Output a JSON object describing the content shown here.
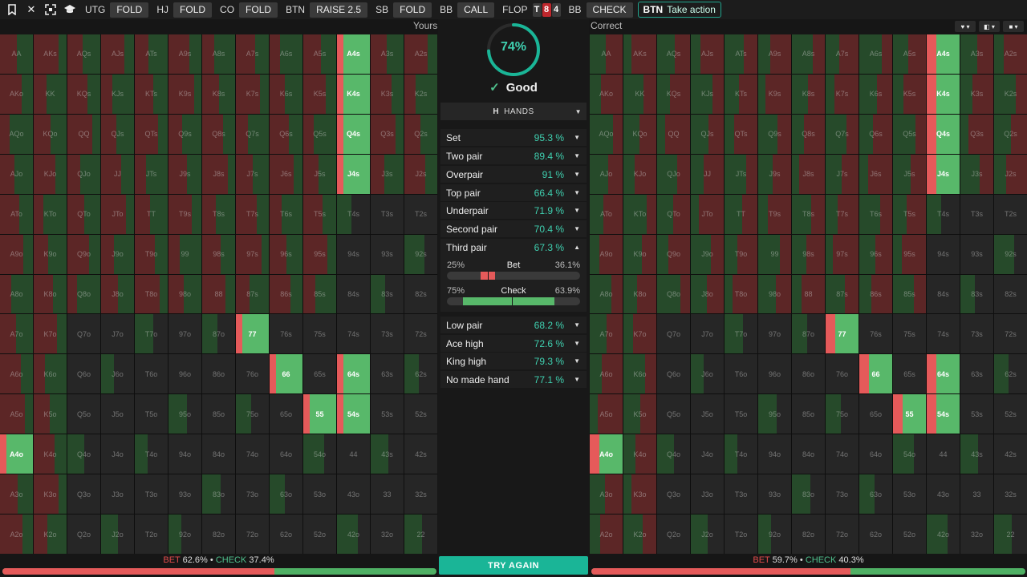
{
  "topbar": {
    "actions": [
      {
        "pos": "UTG",
        "action": "FOLD"
      },
      {
        "pos": "HJ",
        "action": "FOLD"
      },
      {
        "pos": "CO",
        "action": "FOLD"
      },
      {
        "pos": "BTN",
        "action": "RAISE 2.5"
      },
      {
        "pos": "SB",
        "action": "FOLD"
      },
      {
        "pos": "BB",
        "action": "CALL"
      }
    ],
    "street": "FLOP",
    "board": [
      {
        "rank": "T",
        "color": "#3a3a3a"
      },
      {
        "rank": "8",
        "color": "#c0272d"
      },
      {
        "rank": "4",
        "color": "#3a3a3a"
      }
    ],
    "after": {
      "pos": "BB",
      "action": "CHECK"
    },
    "take_action": {
      "pos": "BTN",
      "label": "Take action"
    }
  },
  "yours_label": "Yours",
  "correct_label": "Correct",
  "score": {
    "percent": 74,
    "text": "74%",
    "verdict": "Good"
  },
  "hands_label": "HANDS",
  "categories": [
    {
      "name": "Set",
      "pct": "95.3 %"
    },
    {
      "name": "Two pair",
      "pct": "89.4 %"
    },
    {
      "name": "Overpair",
      "pct": "91 %"
    },
    {
      "name": "Top pair",
      "pct": "66.4 %"
    },
    {
      "name": "Underpair",
      "pct": "71.9 %"
    },
    {
      "name": "Second pair",
      "pct": "70.4 %"
    },
    {
      "name": "Third pair",
      "pct": "67.3 %"
    },
    {
      "name": "Low pair",
      "pct": "68.2 %"
    },
    {
      "name": "Ace high",
      "pct": "72.6 %"
    },
    {
      "name": "King high",
      "pct": "79.3 %"
    },
    {
      "name": "No made hand",
      "pct": "77.1 %"
    }
  ],
  "expanded": {
    "bet": {
      "label": "Bet",
      "yours": "25%",
      "correct": "36.1%",
      "yours_frac": 0.25,
      "correct_frac": 0.361
    },
    "check": {
      "label": "Check",
      "yours": "75%",
      "correct": "63.9%",
      "yours_frac": 0.75,
      "correct_frac": 0.639
    }
  },
  "try_again": "TRY AGAIN",
  "summary_yours": {
    "bet_label": "BET",
    "bet": "62.6%",
    "check_label": "CHECK",
    "check": "37.4%",
    "bet_frac": 0.626
  },
  "summary_correct": {
    "bet_label": "BET",
    "bet": "59.7%",
    "check_label": "CHECK",
    "check": "40.3%",
    "bet_frac": 0.597
  },
  "colors": {
    "bet": "#e55a5a",
    "check": "#58b86a",
    "bet_dim": "#5c2626",
    "check_dim": "#264a2a",
    "fold": "#262626",
    "accent": "#1ab597"
  },
  "highlights": {
    "bet_check": [
      "A4s",
      "K4s",
      "Q4s",
      "J4s",
      "77",
      "66",
      "55",
      "64s",
      "54s",
      "A4o"
    ]
  },
  "grid_labels": [
    [
      "AA",
      "AKs",
      "AQs",
      "AJs",
      "ATs",
      "A9s",
      "A8s",
      "A7s",
      "A6s",
      "A5s",
      "A4s",
      "A3s",
      "A2s"
    ],
    [
      "AKo",
      "KK",
      "KQs",
      "KJs",
      "KTs",
      "K9s",
      "K8s",
      "K7s",
      "K6s",
      "K5s",
      "K4s",
      "K3s",
      "K2s"
    ],
    [
      "AQo",
      "KQo",
      "QQ",
      "QJs",
      "QTs",
      "Q9s",
      "Q8s",
      "Q7s",
      "Q6s",
      "Q5s",
      "Q4s",
      "Q3s",
      "Q2s"
    ],
    [
      "AJo",
      "KJo",
      "QJo",
      "JJ",
      "JTs",
      "J9s",
      "J8s",
      "J7s",
      "J6s",
      "J5s",
      "J4s",
      "J3s",
      "J2s"
    ],
    [
      "ATo",
      "KTo",
      "QTo",
      "JTo",
      "TT",
      "T9s",
      "T8s",
      "T7s",
      "T6s",
      "T5s",
      "T4s",
      "T3s",
      "T2s"
    ],
    [
      "A9o",
      "K9o",
      "Q9o",
      "J9o",
      "T9o",
      "99",
      "98s",
      "97s",
      "96s",
      "95s",
      "94s",
      "93s",
      "92s"
    ],
    [
      "A8o",
      "K8o",
      "Q8o",
      "J8o",
      "T8o",
      "98o",
      "88",
      "87s",
      "86s",
      "85s",
      "84s",
      "83s",
      "82s"
    ],
    [
      "A7o",
      "K7o",
      "Q7o",
      "J7o",
      "T7o",
      "97o",
      "87o",
      "77",
      "76s",
      "75s",
      "74s",
      "73s",
      "72s"
    ],
    [
      "A6o",
      "K6o",
      "Q6o",
      "J6o",
      "T6o",
      "96o",
      "86o",
      "76o",
      "66",
      "65s",
      "64s",
      "63s",
      "62s"
    ],
    [
      "A5o",
      "K5o",
      "Q5o",
      "J5o",
      "T5o",
      "95o",
      "85o",
      "75o",
      "65o",
      "55",
      "54s",
      "53s",
      "52s"
    ],
    [
      "A4o",
      "K4o",
      "Q4o",
      "J4o",
      "T4o",
      "94o",
      "84o",
      "74o",
      "64o",
      "54o",
      "44",
      "43s",
      "42s"
    ],
    [
      "A3o",
      "K3o",
      "Q3o",
      "J3o",
      "T3o",
      "93o",
      "83o",
      "73o",
      "63o",
      "53o",
      "43o",
      "33",
      "32s"
    ],
    [
      "A2o",
      "K2o",
      "Q2o",
      "J2o",
      "T2o",
      "92o",
      "82o",
      "72o",
      "62o",
      "52o",
      "42o",
      "32o",
      "22"
    ]
  ]
}
